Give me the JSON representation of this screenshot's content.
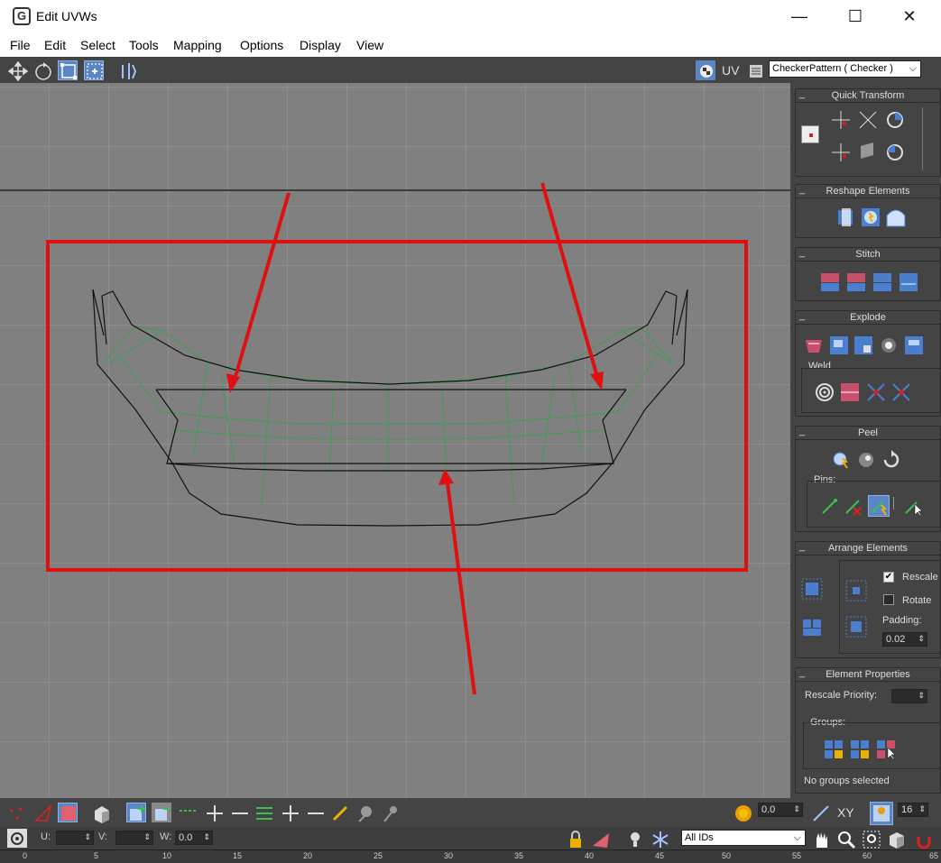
{
  "window": {
    "title": "Edit UVWs",
    "icon": "3ds-max-icon",
    "minimize": "—",
    "maximize": "☐",
    "close": "✕"
  },
  "menu": [
    "File",
    "Edit",
    "Select",
    "Tools",
    "Mapping",
    "Options",
    "Display",
    "View"
  ],
  "toolbar": {
    "uv_label": "UV",
    "texture_dropdown": "CheckerPattern  ( Checker )",
    "tools": [
      "move-icon",
      "rotate-icon",
      "scale-icon",
      "freeform-icon",
      "mirror-icon"
    ]
  },
  "panel": {
    "quick_transform": {
      "title": "Quick Transform"
    },
    "reshape": {
      "title": "Reshape Elements"
    },
    "stitch": {
      "title": "Stitch"
    },
    "explode": {
      "title": "Explode",
      "weld_label": "Weld"
    },
    "peel": {
      "title": "Peel",
      "pins_label": "Pins:"
    },
    "arrange": {
      "title": "Arrange Elements",
      "rescale_label": "Rescale",
      "rescale_checked": true,
      "rotate_label": "Rotate",
      "rotate_checked": false,
      "padding_label": "Padding:",
      "padding_value": "0.02"
    },
    "element_props": {
      "title": "Element Properties",
      "rescale_priority_label": "Rescale Priority:",
      "groups_label": "Groups:",
      "status": "No groups selected"
    }
  },
  "bottom": {
    "angle_value": "0.0",
    "xy_label": "XY",
    "grid_value": "16",
    "u_label": "U:",
    "v_label": "V:",
    "w_label": "W:",
    "w_value": "0.0",
    "ids_dropdown": "All IDs"
  },
  "ruler": [
    "0",
    "5",
    "10",
    "15",
    "20",
    "25",
    "30",
    "35",
    "40",
    "45",
    "50",
    "55",
    "60",
    "65"
  ],
  "colors": {
    "accent": "#5b86c5",
    "annotation": "#e01010",
    "viewport": "#808080"
  }
}
